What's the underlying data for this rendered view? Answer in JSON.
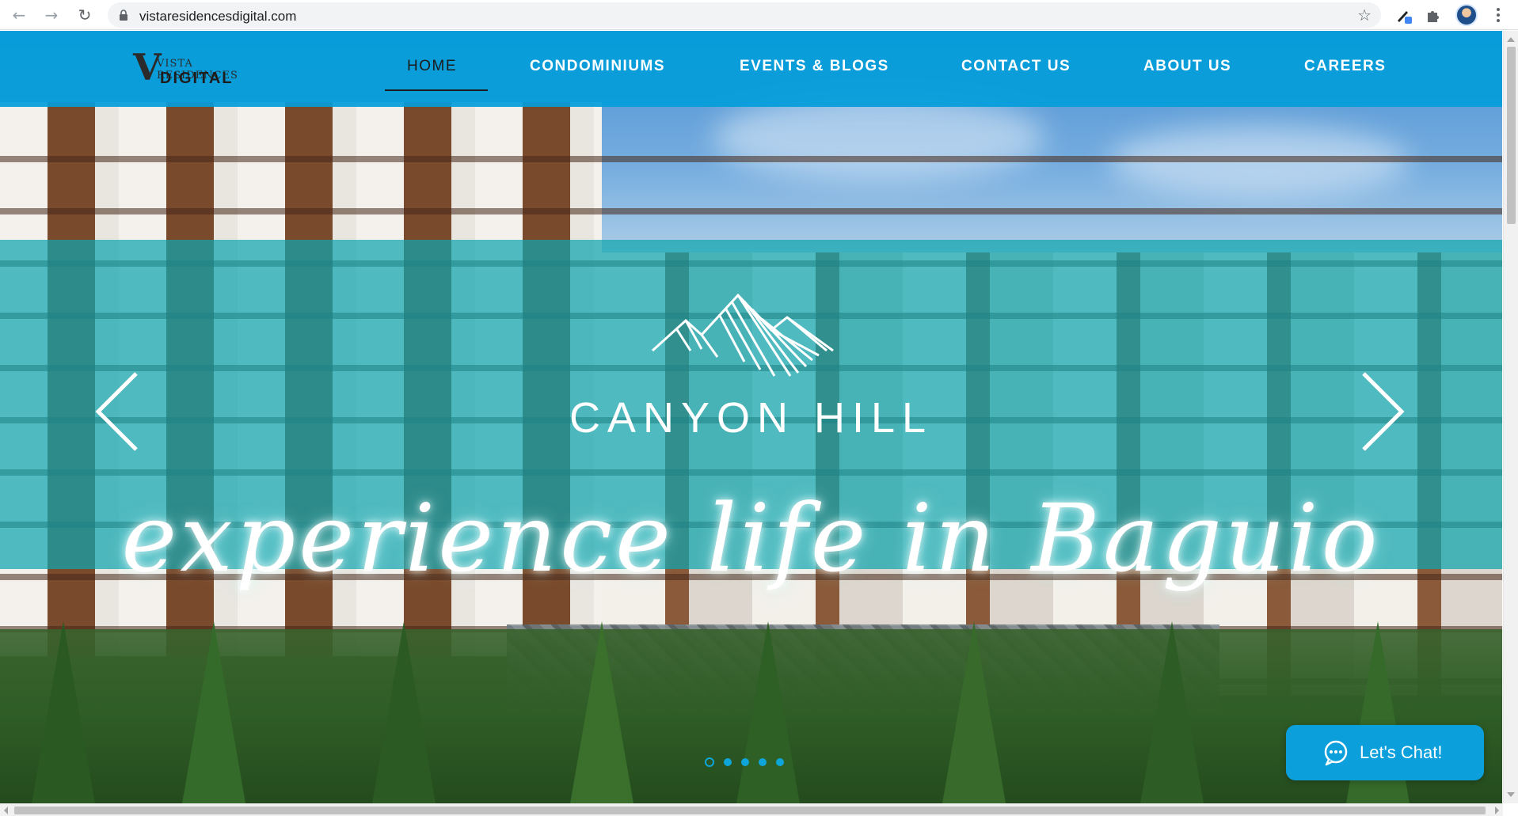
{
  "browser": {
    "url": "vistaresidencesdigital.com"
  },
  "site": {
    "logo_small": "VISTA RESIDENCES",
    "logo_big": "DIGITAL",
    "logo_letter": "V"
  },
  "nav": {
    "items": [
      {
        "label": "HOME",
        "active": true
      },
      {
        "label": "CONDOMINIUMS"
      },
      {
        "label": "EVENTS & BLOGS"
      },
      {
        "label": "CONTACT US"
      },
      {
        "label": "ABOUT US"
      },
      {
        "label": "CAREERS"
      }
    ]
  },
  "hero": {
    "title": "CANYON HILL",
    "tagline": "experience life in Baguio",
    "slides_count": 5,
    "active_slide": 1
  },
  "chat": {
    "label": "Let's Chat!"
  },
  "colors": {
    "header": "#039dda",
    "band": "#0fa5af",
    "chat": "#0b9fdc",
    "active_nav": "#1c1c1c"
  },
  "icons": [
    "back-arrow-icon",
    "forward-arrow-icon",
    "reload-icon",
    "lock-icon",
    "star-icon",
    "pen-extension-icon",
    "puzzle-icon",
    "profile-avatar",
    "menu-dots-icon",
    "mountain-logo-icon",
    "chevron-left-icon",
    "chevron-right-icon",
    "chat-bubble-icon"
  ]
}
